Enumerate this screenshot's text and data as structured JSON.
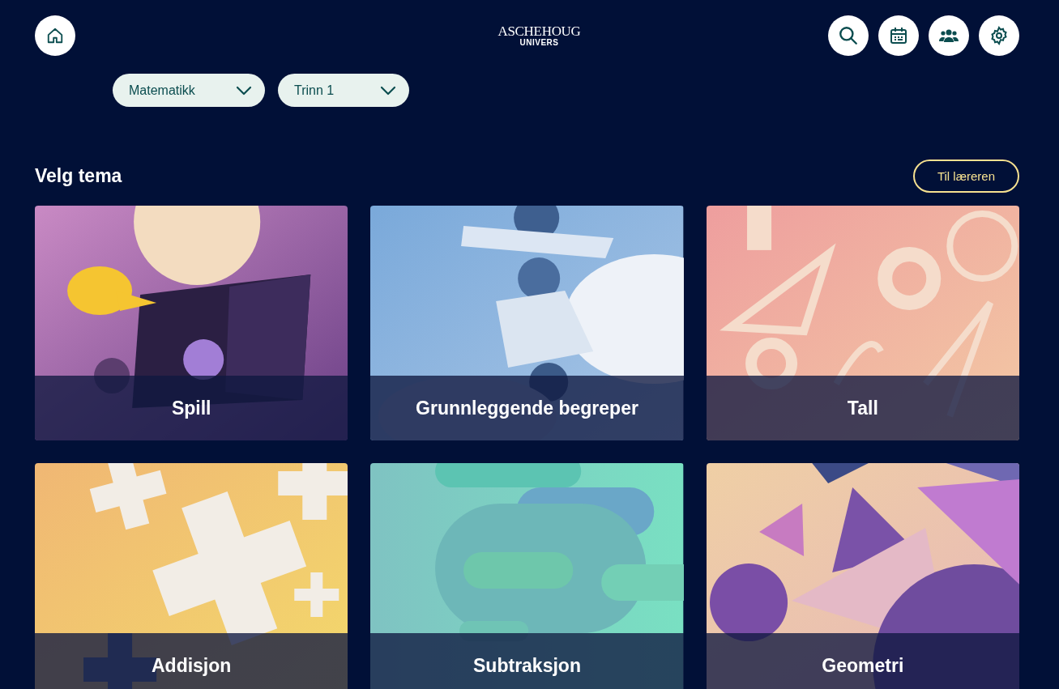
{
  "header": {
    "logo": {
      "top": "ASCHEHOUG",
      "bottom": "UNIVERS"
    },
    "actions": [
      {
        "kind": "search"
      },
      {
        "kind": "calendar"
      },
      {
        "kind": "group"
      },
      {
        "kind": "settings"
      }
    ]
  },
  "filters": [
    {
      "value": "Matematikk"
    },
    {
      "value": "Trinn 1"
    }
  ],
  "section": {
    "title": "Velg tema",
    "teacher_button": "Til læreren"
  },
  "themes": [
    {
      "title": "Spill"
    },
    {
      "title": "Grunnleggende begreper"
    },
    {
      "title": "Tall"
    },
    {
      "title": "Addisjon"
    },
    {
      "title": "Subtraksjon"
    },
    {
      "title": "Geometri"
    }
  ]
}
